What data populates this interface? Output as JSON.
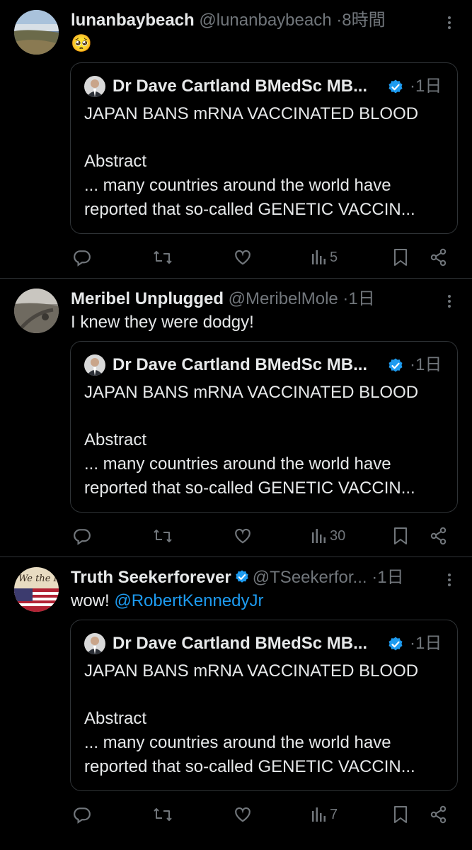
{
  "colors": {
    "background": "#000000",
    "text": "#e7e9ea",
    "secondary": "#71767b",
    "accent": "#1d9bf0",
    "border": "#2f3336"
  },
  "icons": {
    "reply": "reply-icon",
    "repost": "repost-icon",
    "like": "like-icon",
    "views": "views-icon",
    "bookmark": "bookmark-icon",
    "share": "share-icon",
    "more": "more-icon",
    "verified": "verified-badge-icon"
  },
  "tweets": [
    {
      "display_name": "lunanbaybeach",
      "handle": "@lunanbaybeach",
      "sep": "·",
      "time": "8時間",
      "text": "🥺",
      "mention": "",
      "views": "5",
      "quote": {
        "name": "Dr Dave Cartland BMedSc MB...",
        "time": "·1日",
        "line1": "JAPAN BANS mRNA VACCINATED BLOOD",
        "line2": "Abstract",
        "line3": "... many countries around the world have",
        "line4": "reported that so-called GENETIC VACCIN..."
      }
    },
    {
      "display_name": "Meribel Unplugged",
      "handle": "@MeribelMole",
      "sep": "·",
      "time": "1日",
      "text": "I knew they were dodgy!",
      "mention": "",
      "views": "30",
      "quote": {
        "name": "Dr Dave Cartland BMedSc MB...",
        "time": "·1日",
        "line1": "JAPAN BANS mRNA VACCINATED BLOOD",
        "line2": "Abstract",
        "line3": "... many countries around the world have",
        "line4": "reported that so-called GENETIC VACCIN..."
      }
    },
    {
      "display_name": "Truth Seekerforever",
      "handle": "@TSeekerfor...",
      "sep": "·",
      "time": "1日",
      "text": "wow!",
      "mention": "@RobertKennedyJr",
      "views": "7",
      "quote": {
        "name": "Dr Dave Cartland BMedSc MB...",
        "time": "·1日",
        "line1": "JAPAN BANS mRNA VACCINATED BLOOD",
        "line2": "Abstract",
        "line3": "... many countries around the world have",
        "line4": "reported that so-called GENETIC VACCIN..."
      }
    }
  ]
}
